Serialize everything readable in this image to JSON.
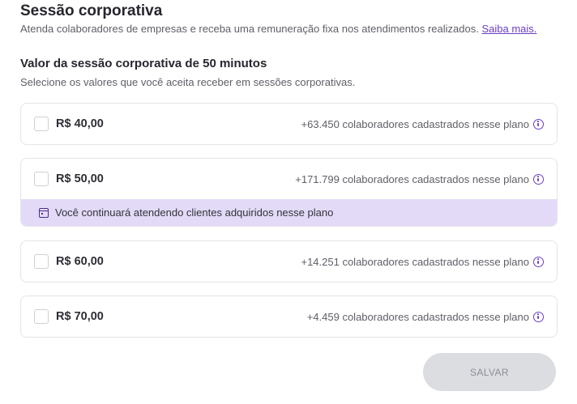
{
  "header": {
    "title": "Sessão corporativa",
    "subtitle": "Atenda colaboradores de empresas e receba uma remuneração fixa nos atendimentos realizados.",
    "link_label": "Saiba mais."
  },
  "section": {
    "title": "Valor da sessão corporativa de 50 minutos",
    "subtitle": "Selecione os valores que você aceita receber em sessões corporativas."
  },
  "options": [
    {
      "price": "R$ 40,00",
      "info": "+63.450 colaboradores cadastrados nesse plano",
      "checked": false
    },
    {
      "price": "R$ 50,00",
      "info": "+171.799 colaboradores cadastrados nesse plano",
      "checked": false,
      "notice": "Você continuará atendendo clientes adquiridos nesse plano"
    },
    {
      "price": "R$ 60,00",
      "info": "+14.251 colaboradores cadastrados nesse plano",
      "checked": false
    },
    {
      "price": "R$ 70,00",
      "info": "+4.459 colaboradores cadastrados nesse plano",
      "checked": false
    }
  ],
  "icons": {
    "info": "info-icon",
    "notice": "calendar-icon"
  },
  "colors": {
    "accent": "#6b3fc4",
    "notice_bg": "#e3daf7",
    "button_bg": "#dcdde1"
  },
  "footer": {
    "save_label": "SALVAR"
  }
}
